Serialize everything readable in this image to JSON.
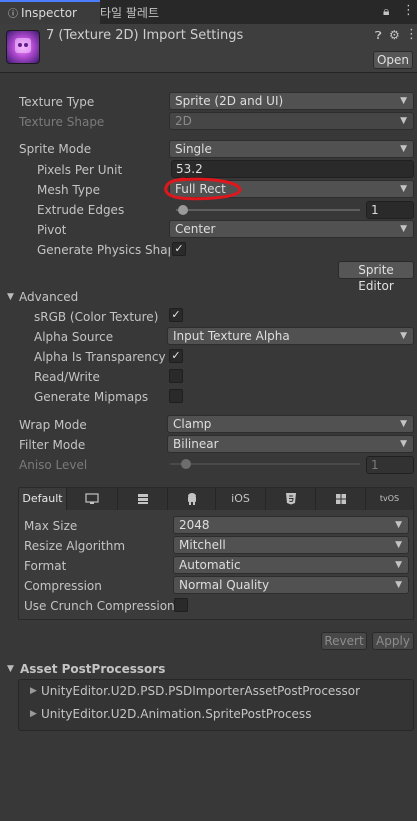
{
  "tabs": {
    "inspector": "Inspector",
    "palette": "타일 팔레트"
  },
  "header": {
    "title": "7 (Texture 2D) Import Settings",
    "open_label": "Open"
  },
  "settings": {
    "texture_type": {
      "label": "Texture Type",
      "value": "Sprite (2D and UI)"
    },
    "texture_shape": {
      "label": "Texture Shape",
      "value": "2D"
    },
    "sprite_mode": {
      "label": "Sprite Mode",
      "value": "Single"
    },
    "pixels_per_unit": {
      "label": "Pixels Per Unit",
      "value": "53.2"
    },
    "mesh_type": {
      "label": "Mesh Type",
      "value": "Full Rect"
    },
    "extrude_edges": {
      "label": "Extrude Edges",
      "value": "1"
    },
    "pivot": {
      "label": "Pivot",
      "value": "Center"
    },
    "generate_physics_shape": {
      "label": "Generate Physics Shape",
      "checked": true
    },
    "sprite_editor_label": "Sprite Editor"
  },
  "advanced": {
    "title": "Advanced",
    "srgb": {
      "label": "sRGB (Color Texture)",
      "checked": true
    },
    "alpha_source": {
      "label": "Alpha Source",
      "value": "Input Texture Alpha"
    },
    "alpha_is_transparency": {
      "label": "Alpha Is Transparency",
      "checked": true
    },
    "read_write": {
      "label": "Read/Write",
      "checked": false
    },
    "generate_mipmaps": {
      "label": "Generate Mipmaps",
      "checked": false
    }
  },
  "wrap": {
    "wrap_mode": {
      "label": "Wrap Mode",
      "value": "Clamp"
    },
    "filter_mode": {
      "label": "Filter Mode",
      "value": "Bilinear"
    },
    "aniso_level": {
      "label": "Aniso Level",
      "value": "1"
    }
  },
  "platform": {
    "tabs": [
      "Default",
      "",
      "",
      "",
      "iOS",
      "",
      "",
      "tvOS"
    ],
    "max_size": {
      "label": "Max Size",
      "value": "2048"
    },
    "resize_algorithm": {
      "label": "Resize Algorithm",
      "value": "Mitchell"
    },
    "format": {
      "label": "Format",
      "value": "Automatic"
    },
    "compression": {
      "label": "Compression",
      "value": "Normal Quality"
    },
    "use_crunch": {
      "label": "Use Crunch Compression",
      "checked": false
    }
  },
  "actions": {
    "revert": "Revert",
    "apply": "Apply"
  },
  "postprocessors": {
    "title": "Asset PostProcessors",
    "items": [
      "UnityEditor.U2D.PSD.PSDImporterAssetPostProcessor",
      "UnityEditor.U2D.Animation.SpritePostProcess"
    ]
  },
  "annotation": {
    "color": "#e0161d"
  }
}
